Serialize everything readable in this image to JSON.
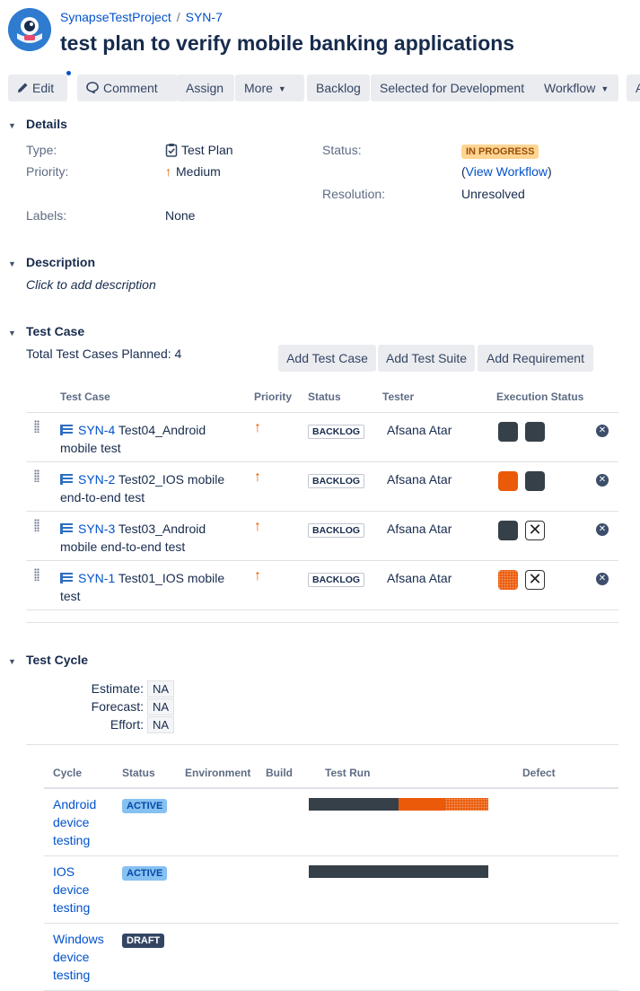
{
  "breadcrumb": {
    "project": "SynapseTestProject",
    "separator": "/",
    "issue_key": "SYN-7"
  },
  "issue": {
    "title": "test plan to verify mobile banking applications"
  },
  "toolbar": {
    "edit": "Edit",
    "comment": "Comment",
    "assign": "Assign",
    "more": "More",
    "backlog": "Backlog",
    "selected": "Selected for Development",
    "workflow": "Workflow",
    "overflow": "A"
  },
  "details": {
    "heading": "Details",
    "type_label": "Type:",
    "type_value": "Test Plan",
    "priority_label": "Priority:",
    "priority_value": "Medium",
    "labels_label": "Labels:",
    "labels_value": "None",
    "status_label": "Status:",
    "status_value": "IN PROGRESS",
    "view_workflow_open": "(",
    "view_workflow": "View Workflow",
    "view_workflow_close": ")",
    "resolution_label": "Resolution:",
    "resolution_value": "Unresolved"
  },
  "description": {
    "heading": "Description",
    "placeholder": "Click to add description"
  },
  "test_case": {
    "heading": "Test Case",
    "total": "Total Test Cases Planned: 4",
    "buttons": {
      "add_case": "Add Test Case",
      "add_suite": "Add Test Suite",
      "add_req": "Add Requirement"
    },
    "columns": {
      "name": "Test Case",
      "priority": "Priority",
      "status": "Status",
      "tester": "Tester",
      "execution": "Execution Status"
    },
    "rows": [
      {
        "key": "SYN-4",
        "line1": " Test04_Android",
        "line2": "mobile test",
        "priority": "↑",
        "status": "BACKLOG",
        "tester": "Afsana Atar"
      },
      {
        "key": "SYN-2",
        "line1": " Test02_IOS mobile",
        "line2": "end-to-end test",
        "priority": "↑",
        "status": "BACKLOG",
        "tester": "Afsana Atar"
      },
      {
        "key": "SYN-3",
        "line1": " Test03_Android",
        "line2": "mobile end-to-end test",
        "priority": "↑",
        "status": "BACKLOG",
        "tester": "Afsana Atar"
      },
      {
        "key": "SYN-1",
        "line1": " Test01_IOS mobile",
        "line2": "test",
        "priority": "↑",
        "status": "BACKLOG",
        "tester": "Afsana Atar"
      }
    ]
  },
  "test_cycle": {
    "heading": "Test Cycle",
    "estimate_label": "Estimate:",
    "estimate_value": "NA",
    "forecast_label": "Forecast:",
    "forecast_value": "NA",
    "effort_label": "Effort:",
    "effort_value": "NA",
    "columns": {
      "cycle": "Cycle",
      "status": "Status",
      "environment": "Environment",
      "build": "Build",
      "test_run": "Test Run",
      "defect": "Defect"
    },
    "rows": [
      {
        "line1": "Android",
        "line2": "device",
        "line3": "testing",
        "status": "ACTIVE"
      },
      {
        "line1": "IOS",
        "line2": "device",
        "line3": "testing",
        "status": "ACTIVE"
      },
      {
        "line1": "Windows",
        "line2": "device",
        "line3": "testing",
        "status": "DRAFT"
      }
    ]
  },
  "colors": {
    "dark": "#364048",
    "orange": "#eb5a09",
    "link": "#0052cc"
  }
}
